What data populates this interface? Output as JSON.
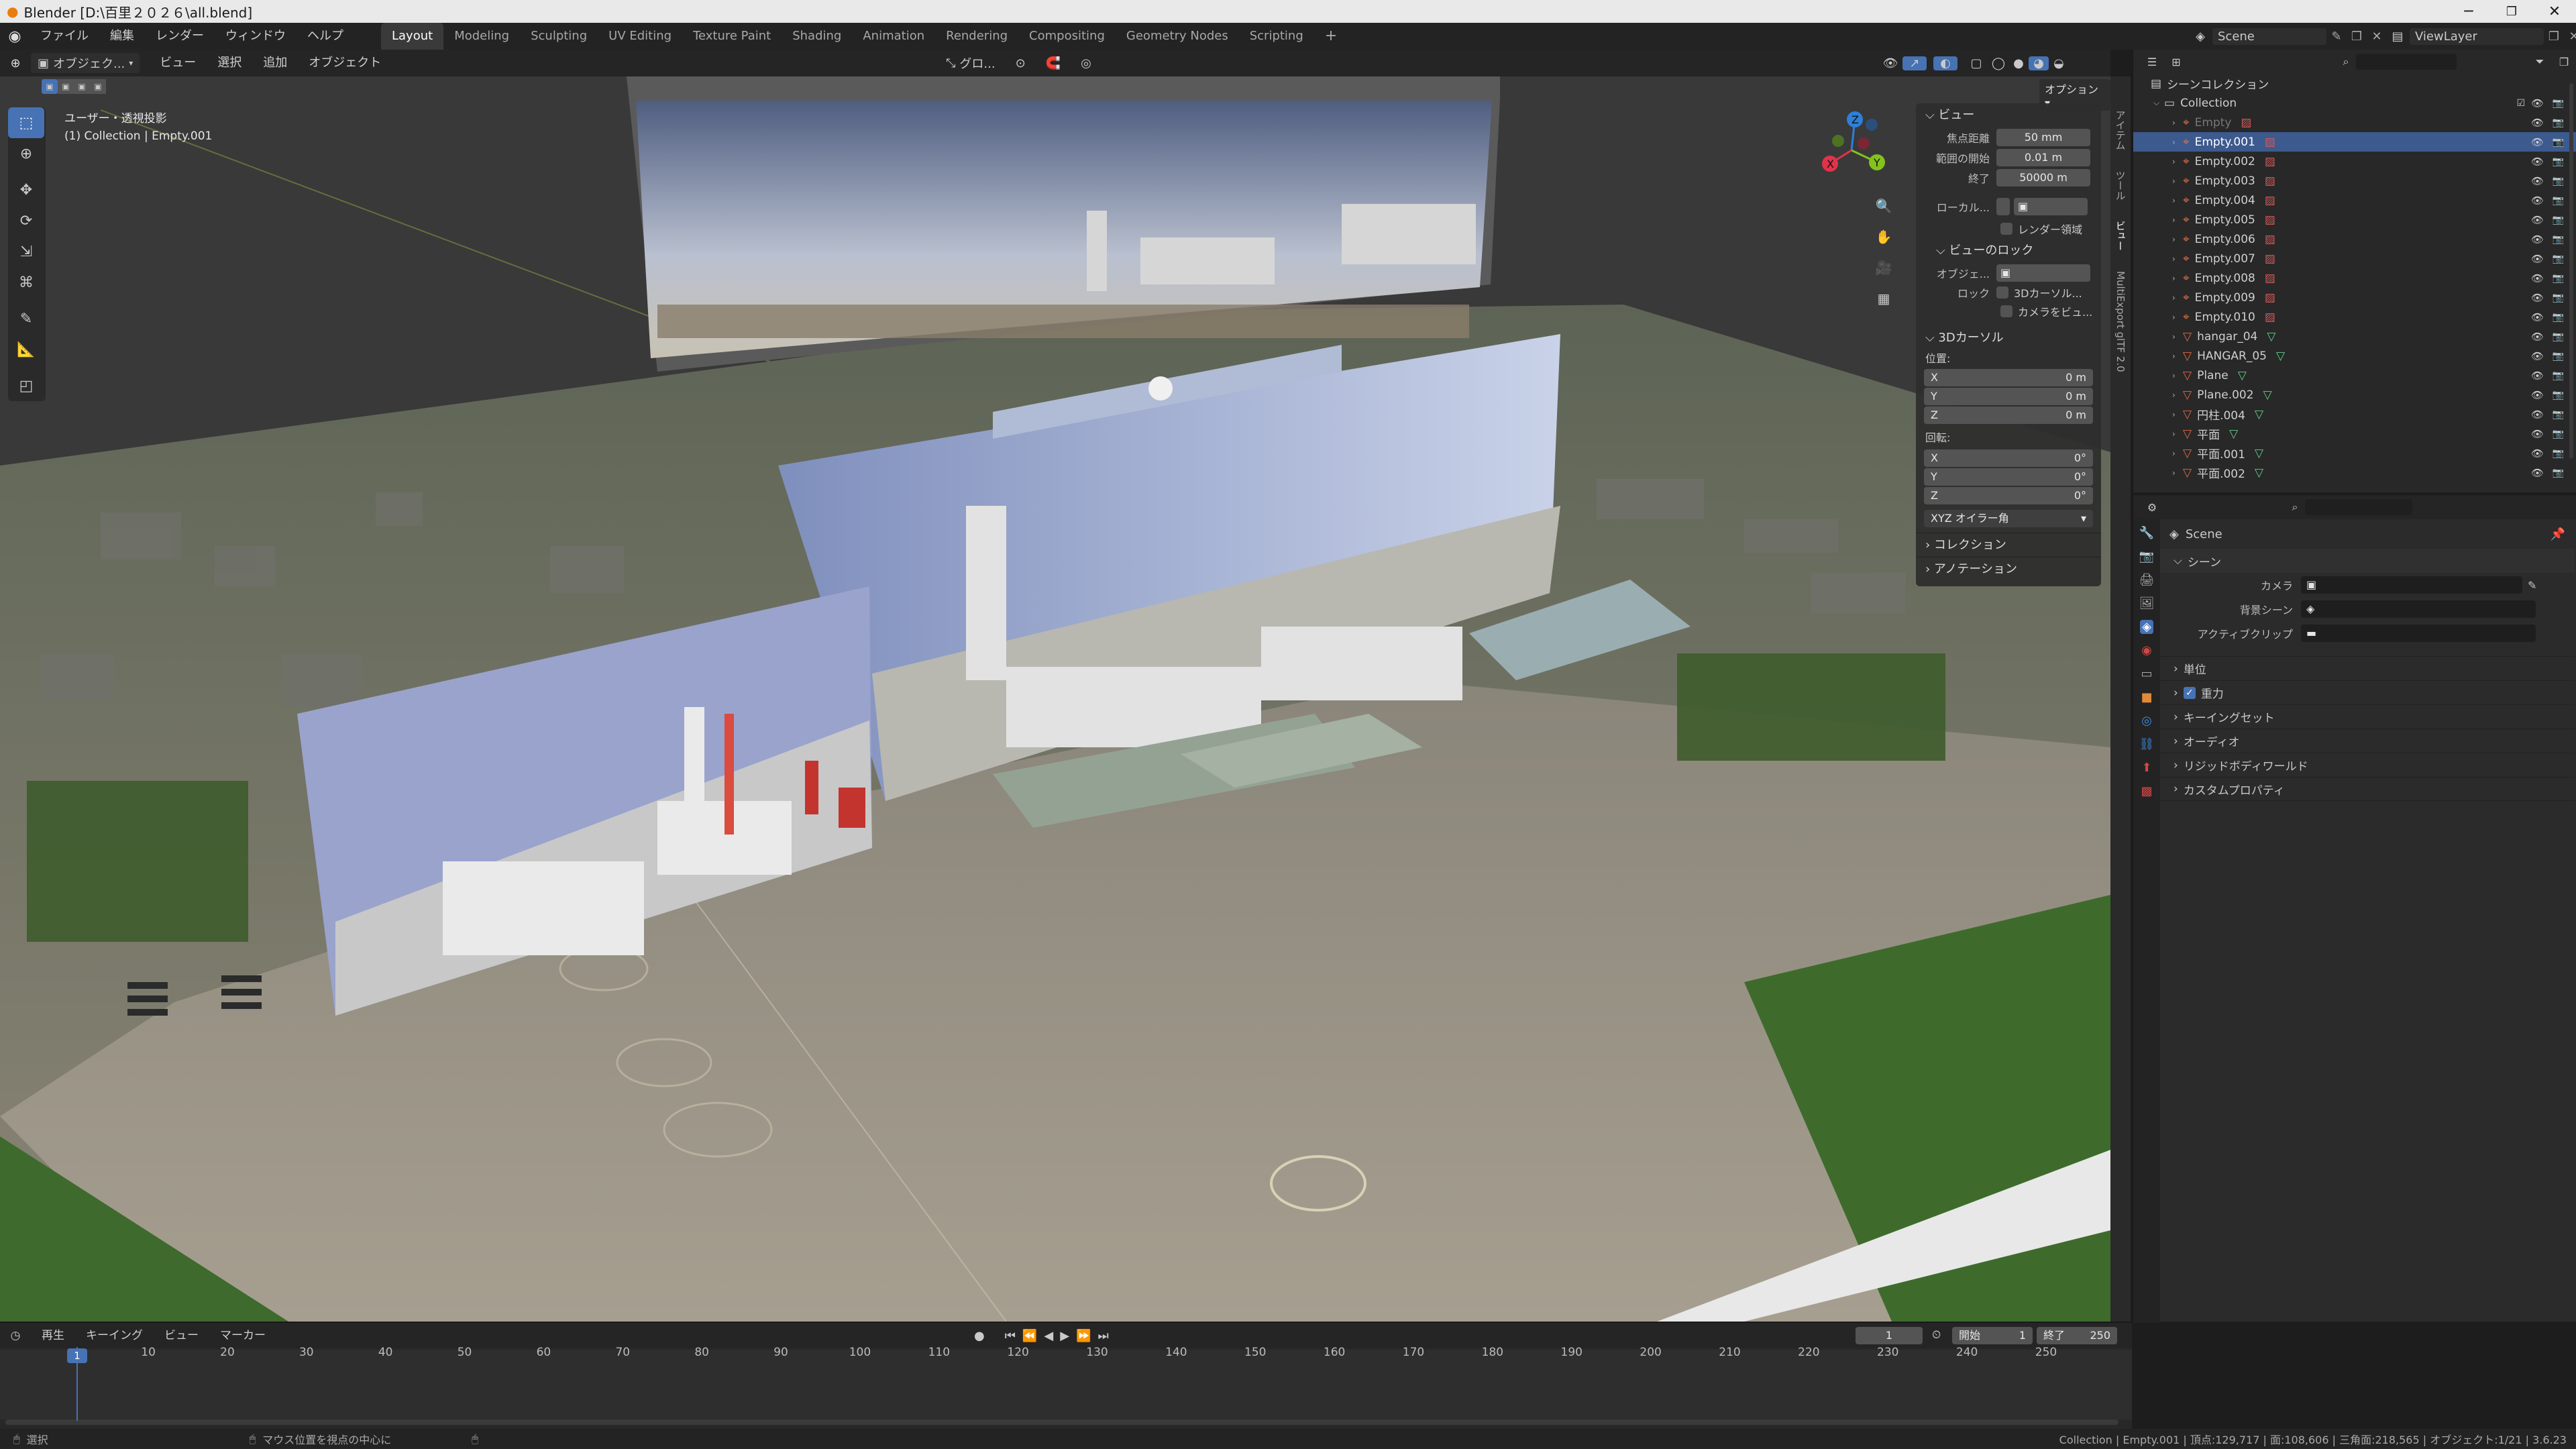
{
  "window": {
    "title": "Blender [D:\\百里２０２６\\all.blend]"
  },
  "menu": {
    "items": [
      "ファイル",
      "編集",
      "レンダー",
      "ウィンドウ",
      "ヘルプ"
    ]
  },
  "workspaces": {
    "tabs": [
      "Layout",
      "Modeling",
      "Sculpting",
      "UV Editing",
      "Texture Paint",
      "Shading",
      "Animation",
      "Rendering",
      "Compositing",
      "Geometry Nodes",
      "Scripting"
    ],
    "active": "Layout"
  },
  "viewport_header": {
    "mode": "オブジェク...",
    "menus": [
      "ビュー",
      "選択",
      "追加",
      "オブジェクト"
    ],
    "transform": "グロ...",
    "options": "オプション"
  },
  "viewport": {
    "overlay_line1": "ユーザー・透視投影",
    "overlay_line2": "(1) Collection | Empty.001"
  },
  "npanel": {
    "view_header": "ビュー",
    "focal_label": "焦点距離",
    "focal_value": "50 mm",
    "clip_start_label": "範囲の開始",
    "clip_start_value": "0.01 m",
    "clip_end_label": "終了",
    "clip_end_value": "50000 m",
    "local_label": "ローカル...",
    "render_region": "レンダー領域",
    "view_lock_header": "ビューのロック",
    "lock_object_label": "オブジェ...",
    "lock_label": "ロック",
    "lock_3dcursor": "3Dカーソル...",
    "lock_camera": "カメラをビュ...",
    "cursor_header": "3Dカーソル",
    "location_label": "位置:",
    "loc_x": "0 m",
    "loc_y": "0 m",
    "loc_z": "0 m",
    "rotation_label": "回転:",
    "rot_x": "0°",
    "rot_y": "0°",
    "rot_z": "0°",
    "x": "X",
    "y": "Y",
    "z": "Z",
    "rotation_mode": "XYZ オイラー角",
    "collection_header": "コレクション",
    "annotation_header": "アノテーション",
    "tabs": [
      "アイテム",
      "ツール",
      "ビュー",
      "MultiExport glTF 2.0"
    ]
  },
  "topbar_right": {
    "scene": "Scene",
    "view_layer": "ViewLayer"
  },
  "outliner": {
    "root": "シーンコレクション",
    "collection": "Collection",
    "items": [
      {
        "name": "Empty",
        "selected": false,
        "dim": true,
        "type": "empty"
      },
      {
        "name": "Empty.001",
        "selected": true,
        "dim": false,
        "type": "empty"
      },
      {
        "name": "Empty.002",
        "selected": false,
        "dim": false,
        "type": "empty"
      },
      {
        "name": "Empty.003",
        "selected": false,
        "dim": false,
        "type": "empty"
      },
      {
        "name": "Empty.004",
        "selected": false,
        "dim": false,
        "type": "empty"
      },
      {
        "name": "Empty.005",
        "selected": false,
        "dim": false,
        "type": "empty"
      },
      {
        "name": "Empty.006",
        "selected": false,
        "dim": false,
        "type": "empty"
      },
      {
        "name": "Empty.007",
        "selected": false,
        "dim": false,
        "type": "empty"
      },
      {
        "name": "Empty.008",
        "selected": false,
        "dim": false,
        "type": "empty"
      },
      {
        "name": "Empty.009",
        "selected": false,
        "dim": false,
        "type": "empty"
      },
      {
        "name": "Empty.010",
        "selected": false,
        "dim": false,
        "type": "empty"
      },
      {
        "name": "hangar_04",
        "selected": false,
        "dim": false,
        "type": "mesh"
      },
      {
        "name": "HANGAR_05",
        "selected": false,
        "dim": false,
        "type": "mesh"
      },
      {
        "name": "Plane",
        "selected": false,
        "dim": false,
        "type": "mesh"
      },
      {
        "name": "Plane.002",
        "selected": false,
        "dim": false,
        "type": "mesh"
      },
      {
        "name": "円柱.004",
        "selected": false,
        "dim": false,
        "type": "mesh"
      },
      {
        "name": "平面",
        "selected": false,
        "dim": false,
        "type": "mesh"
      },
      {
        "name": "平面.001",
        "selected": false,
        "dim": false,
        "type": "mesh"
      },
      {
        "name": "平面.002",
        "selected": false,
        "dim": false,
        "type": "mesh"
      }
    ]
  },
  "properties": {
    "context": "Scene",
    "scene_header": "シーン",
    "camera_label": "カメラ",
    "background_label": "背景シーン",
    "active_clip_label": "アクティブクリップ",
    "panels": [
      "単位",
      "重力",
      "キーイングセット",
      "オーディオ",
      "リジッドボディワールド",
      "カスタムプロパティ"
    ]
  },
  "timeline": {
    "menus": [
      "再生",
      "キーイング",
      "ビュー",
      "マーカー"
    ],
    "current_frame": "1",
    "start_label": "開始",
    "start": "1",
    "end_label": "終了",
    "end": "250",
    "ticks": [
      "1",
      "10",
      "20",
      "30",
      "40",
      "50",
      "60",
      "70",
      "80",
      "90",
      "100",
      "110",
      "120",
      "130",
      "140",
      "150",
      "160",
      "170",
      "180",
      "190",
      "200",
      "210",
      "220",
      "230",
      "240",
      "250"
    ],
    "playhead": "1"
  },
  "statusbar": {
    "left1": "選択",
    "left2": "マウス位置を視点の中心に",
    "right": "Collection | Empty.001 | 頂点:129,717 | 面:108,606 | 三角面:218,565 | オブジェクト:1/21 | 3.6.23"
  },
  "colors": {
    "accent": "#4772b3",
    "selection": "#3d5a8f",
    "x_axis": "#e0334a",
    "y_axis": "#84c21c",
    "z_axis": "#2e7fd9",
    "empty_icon": "#e06a43",
    "mesh_icon": "#5ed18a"
  }
}
